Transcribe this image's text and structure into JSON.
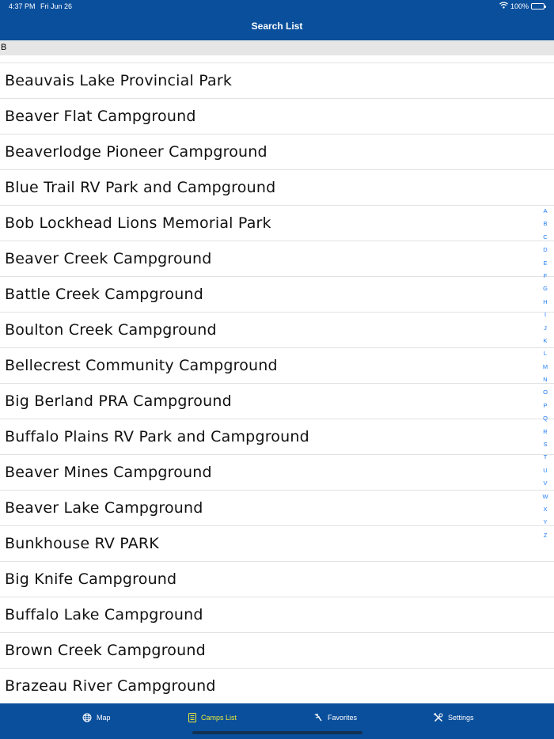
{
  "status": {
    "time": "4:37 PM",
    "date": "Fri Jun 26",
    "battery": "100%"
  },
  "nav": {
    "title": "Search List"
  },
  "section": {
    "header": "B"
  },
  "items": [
    "Beauvais Lake Provincial Park",
    "Beaver Flat Campground",
    "Beaverlodge Pioneer Campground",
    "Blue Trail RV Park and Campground",
    "Bob Lockhead Lions Memorial Park",
    "Beaver Creek Campground",
    "Battle Creek Campground",
    "Boulton Creek Campground",
    "Bellecrest Community Campground",
    "Big Berland PRA Campground",
    "Buffalo Plains RV Park and Campground",
    "Beaver Mines Campground",
    "Beaver Lake Campground",
    "Bunkhouse RV PARK",
    "Big Knife Campground",
    "Buffalo Lake Campground",
    "Brown Creek Campground",
    "Brazeau River Campground"
  ],
  "index_letters": [
    "A",
    "B",
    "C",
    "D",
    "E",
    "F",
    "G",
    "H",
    "I",
    "J",
    "K",
    "L",
    "M",
    "N",
    "O",
    "P",
    "Q",
    "R",
    "S",
    "T",
    "U",
    "V",
    "W",
    "X",
    "Y",
    "Z"
  ],
  "tabs": [
    {
      "label": "Map",
      "icon": "globe-icon"
    },
    {
      "label": "Camps List",
      "icon": "list-icon",
      "active": true
    },
    {
      "label": "Favorites",
      "icon": "favorites-icon"
    },
    {
      "label": "Settings",
      "icon": "settings-tools-icon"
    }
  ],
  "colors": {
    "bar": "#0a4f9c",
    "active_tab": "#e8e839",
    "index": "#1e7bf5"
  }
}
